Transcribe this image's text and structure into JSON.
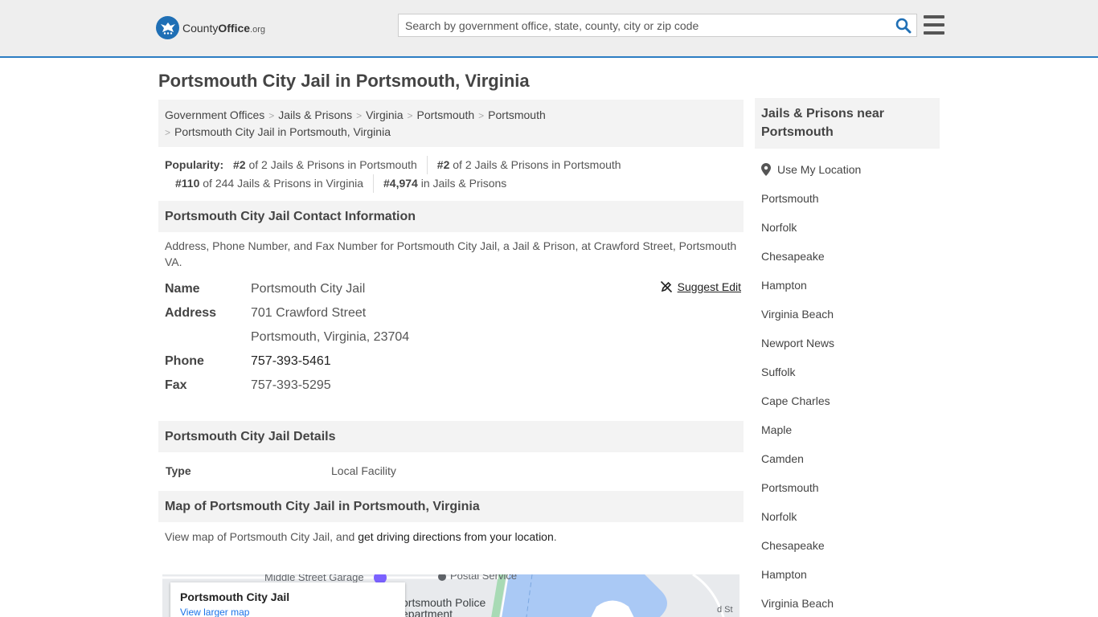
{
  "header": {
    "logo": {
      "brand": "County",
      "brand_bold": "Office",
      "tld": ".org"
    },
    "search": {
      "placeholder": "Search by government office, state, county, city or zip code",
      "value": ""
    },
    "icons": {
      "search": "search-icon",
      "menu": "hamburger-menu-icon",
      "logo": "eagle-seal-icon"
    },
    "accent_color": "#2c7dc3"
  },
  "page": {
    "title": "Portsmouth City Jail in Portsmouth, Virginia"
  },
  "breadcrumb": [
    "Government Offices",
    "Jails & Prisons",
    "Virginia",
    "Portsmouth",
    "Portsmouth",
    "Portsmouth City Jail in Portsmouth, Virginia"
  ],
  "popularity": {
    "label": "Popularity:",
    "items": [
      {
        "rank": "#2",
        "text": " of 2 Jails & Prisons in Portsmouth"
      },
      {
        "rank": "#2",
        "text": " of 2 Jails & Prisons in Portsmouth"
      },
      {
        "rank": "#110",
        "text": " of 244 Jails & Prisons in Virginia"
      },
      {
        "rank": "#4,974",
        "text": " in Jails & Prisons"
      }
    ]
  },
  "contact": {
    "heading": "Portsmouth City Jail Contact Information",
    "description": "Address, Phone Number, and Fax Number for Portsmouth City Jail, a Jail & Prison, at Crawford Street, Portsmouth VA.",
    "suggest_edit": "Suggest Edit",
    "rows": {
      "name_label": "Name",
      "name_value": "Portsmouth City Jail",
      "address_label": "Address",
      "address_line1": "701 Crawford Street",
      "address_line2": "Portsmouth, Virginia, 23704",
      "phone_label": "Phone",
      "phone_value": "757-393-5461",
      "fax_label": "Fax",
      "fax_value": "757-393-5295"
    }
  },
  "details": {
    "heading": "Portsmouth City Jail Details",
    "type_label": "Type",
    "type_value": "Local Facility"
  },
  "map_section": {
    "heading": "Map of Portsmouth City Jail in Portsmouth, Virginia",
    "text_before": "View map of Portsmouth City Jail, and ",
    "link": "get driving directions from your location",
    "text_after": ".",
    "card_title": "Portsmouth City Jail",
    "card_link": "View larger map",
    "labels": {
      "garage": "Middle Street Garage",
      "postal": "Postal Service",
      "police_1": "ortsmouth Police",
      "police_2": "epartment",
      "street": "d St"
    }
  },
  "sidebar": {
    "heading": "Jails & Prisons near Portsmouth",
    "use_location": "Use My Location",
    "items": [
      "Portsmouth",
      "Norfolk",
      "Chesapeake",
      "Hampton",
      "Virginia Beach",
      "Newport News",
      "Suffolk",
      "Cape Charles",
      "Maple",
      "Camden",
      "Portsmouth",
      "Norfolk",
      "Chesapeake",
      "Hampton",
      "Virginia Beach"
    ]
  }
}
